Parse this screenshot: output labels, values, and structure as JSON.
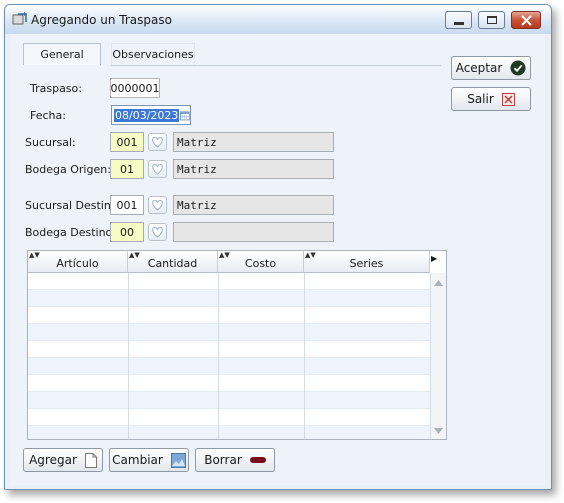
{
  "window": {
    "title": "Agregando un Traspaso",
    "minimize_icon": "minimize-icon",
    "maximize_icon": "maximize-icon",
    "close_icon": "close-icon"
  },
  "tabs": [
    {
      "label": "General",
      "active": true
    },
    {
      "label": "Observaciones",
      "active": false
    }
  ],
  "form": {
    "traspaso_label": "Traspaso:",
    "traspaso_value": "0000001",
    "fecha_label": "Fecha:",
    "fecha_value": "08/03/2023",
    "sucursal_label": "Sucursal:",
    "sucursal_code": "001",
    "sucursal_name": "Matriz",
    "bodega_origen_label": "Bodega Origen:",
    "bodega_origen_code": "01",
    "bodega_origen_name": "Matriz",
    "sucursal_destino_label": "Sucursal Destino:",
    "sucursal_destino_code": "001",
    "sucursal_destino_name": "Matriz",
    "bodega_destino_label": "Bodega Destino:",
    "bodega_destino_code": "00",
    "bodega_destino_name": ""
  },
  "actions": {
    "aceptar_label": "Aceptar",
    "salir_label": "Salir"
  },
  "grid": {
    "columns": [
      "Artículo",
      "Cantidad",
      "Costo",
      "Series"
    ],
    "rows": [],
    "visible_empty_rows": 10
  },
  "bottom_buttons": {
    "agregar_label": "Agregar",
    "cambiar_label": "Cambiar",
    "borrar_label": "Borrar"
  },
  "colors": {
    "required_field": "#f5fcc4",
    "readonly_field": "#e6e6e6",
    "selection": "#3b78d8",
    "close_button": "#c8543a"
  }
}
